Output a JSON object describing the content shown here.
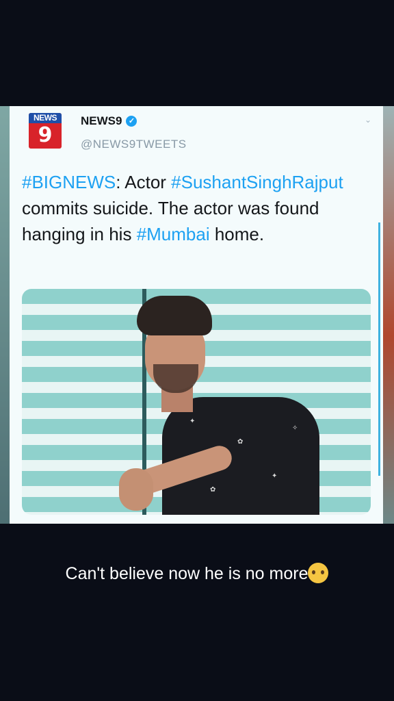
{
  "tweet": {
    "logo": {
      "top": "NEWS",
      "number": "9"
    },
    "display_name": "NEWS9",
    "handle": "@NEWS9TWEETS",
    "text_parts": {
      "p1": "#BIGNEWS",
      "p2": ": Actor ",
      "p3": "#SushantSinghRajput",
      "p4": " commits suicide. The actor was found hanging in his ",
      "p5": "#Mumbai",
      "p6": " home."
    },
    "verified_icon": "verified-badge-icon",
    "menu_icon": "chevron-down-icon",
    "photo": "man-leaning-on-railing-photo"
  },
  "caption": {
    "text": "Can't believe now he  is no more",
    "emoji": "pleading-tear-emoji"
  },
  "colors": {
    "background": "#0a0d17",
    "card": "#f4fbfc",
    "hashtag": "#1da1f2",
    "text": "#14171a",
    "handle": "#8899a6"
  }
}
